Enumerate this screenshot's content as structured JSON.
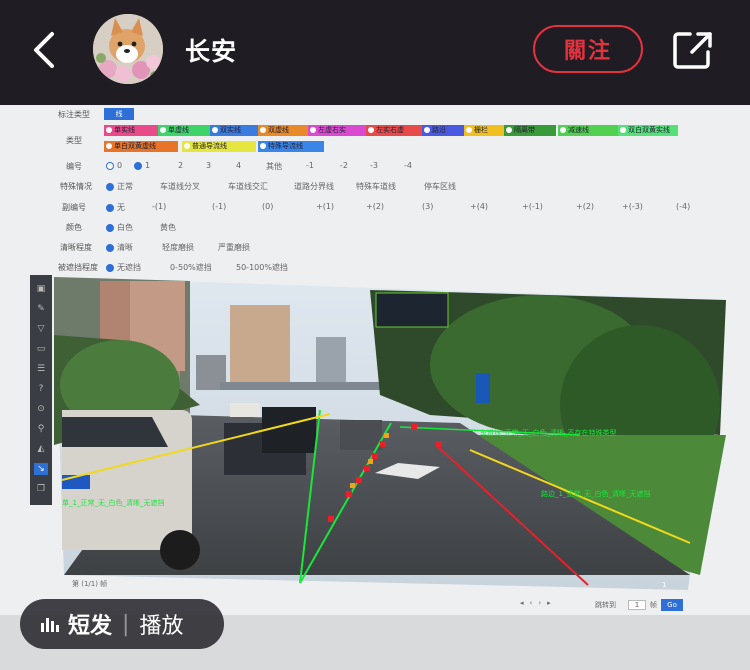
{
  "header": {
    "username": "长安",
    "follow_label": "關注"
  },
  "annotation_panel": {
    "label_type": {
      "label": "标注类型",
      "value": "线"
    },
    "type": {
      "label": "类型",
      "options": [
        "单实线",
        "单虚线",
        "双实线",
        "双虚线",
        "左虚右实",
        "左实右虚",
        "路沿",
        "栅栏",
        "隔离带",
        "减速线",
        "双白双黄实线",
        "单白双黄虚线",
        "普通导流线",
        "特殊导流线"
      ]
    },
    "number": {
      "label": "编号",
      "options": [
        "0",
        "1",
        "2",
        "3",
        "4",
        "其他",
        "-1",
        "-2",
        "-3",
        "-4"
      ]
    },
    "special": {
      "label": "特殊情况",
      "options": [
        "正常",
        "车道线分叉",
        "车道线交汇",
        "道路分界线",
        "特殊车道线",
        "停车区线"
      ]
    },
    "sub_number": {
      "label": "副编号",
      "options": [
        "无",
        "-(1)",
        "(-1)",
        "(0)",
        "+(1)",
        "+(2)",
        "(3)",
        "+(4)",
        "+(-1)",
        "+(2)",
        "+(-3)",
        "(-4)"
      ]
    },
    "color": {
      "label": "颜色",
      "options": [
        "白色",
        "黄色"
      ]
    },
    "clarity": {
      "label": "清晰程度",
      "options": [
        "清晰",
        "轻度磨损",
        "严重磨损"
      ]
    },
    "occlusion": {
      "label": "被遮挡程度",
      "options": [
        "无遮挡",
        "0-50%遮挡",
        "50-100%遮挡"
      ]
    }
  },
  "scene_labels": {
    "left_line": "单_1_正常_无_白色_清晰_无遮挡",
    "right_line": "路边_1_正常_无_白色_清晰_无遮挡",
    "top_line": "车道线_正常_无_白色_清晰_不存在特殊类型",
    "right_point": "1"
  },
  "footer": {
    "page_label": "第 (1/1) 帧",
    "jump_label": "跳转到",
    "page_input": "1",
    "go_label": "Go",
    "page_unit": "帧"
  },
  "overlay": {
    "short_label": "短发",
    "play_label": "播放"
  },
  "colors": {
    "follow": "#e3323e",
    "accent": "#2e6fd8",
    "lane_green": "#18e63a",
    "lane_red": "#e8202a",
    "lane_yellow": "#f2d81a"
  }
}
